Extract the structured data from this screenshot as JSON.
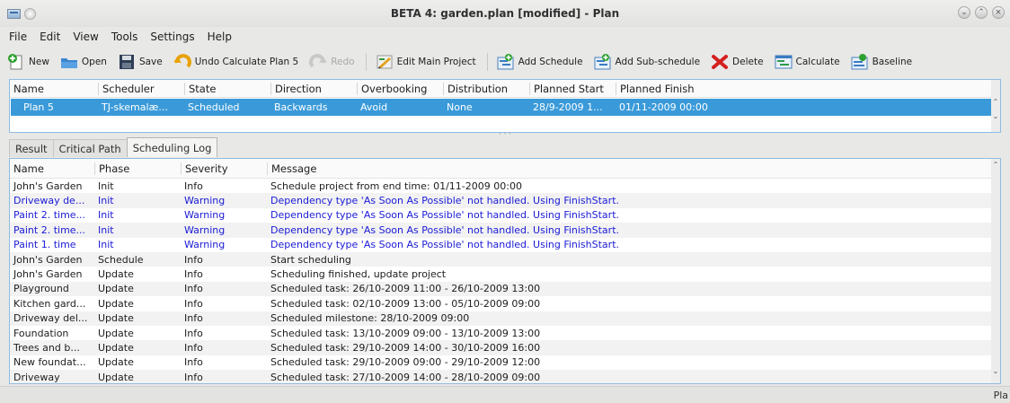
{
  "window": {
    "title": "BETA 4: garden.plan [modified] - Plan"
  },
  "menu": [
    "File",
    "Edit",
    "View",
    "Tools",
    "Settings",
    "Help"
  ],
  "toolbar": {
    "new": "New",
    "open": "Open",
    "save": "Save",
    "undo": "Undo Calculate Plan 5",
    "redo": "Redo",
    "edit_main_project": "Edit Main Project",
    "add_schedule": "Add Schedule",
    "add_subschedule": "Add Sub-schedule",
    "delete": "Delete",
    "calculate": "Calculate",
    "baseline": "Baseline"
  },
  "schedules": {
    "columns": [
      "Name",
      "Scheduler",
      "State",
      "Direction",
      "Overbooking",
      "Distribution",
      "Planned Start",
      "Planned Finish"
    ],
    "row": {
      "name": "Plan 5",
      "scheduler": "TJ-skemalæ...",
      "state": "Scheduled",
      "direction": "Backwards",
      "overbooking": "Avoid",
      "distribution": "None",
      "planned_start": "28/9-2009 1...",
      "planned_finish": "01/11-2009 00:00"
    }
  },
  "tabs": [
    "Result",
    "Critical Path",
    "Scheduling Log"
  ],
  "log": {
    "columns": [
      "Name",
      "Phase",
      "Severity",
      "Message"
    ],
    "rows": [
      {
        "name": "John's Garden",
        "phase": "Init",
        "severity": "Info",
        "message": "Schedule project from end time: 01/11-2009 00:00",
        "warn": false
      },
      {
        "name": "Driveway de...",
        "phase": "Init",
        "severity": "Warning",
        "message": "Dependency type 'As Soon As Possible' not handled. Using FinishStart.",
        "warn": true
      },
      {
        "name": "Paint 2. time...",
        "phase": "Init",
        "severity": "Warning",
        "message": "Dependency type 'As Soon As Possible' not handled. Using FinishStart.",
        "warn": true
      },
      {
        "name": "Paint 2. time...",
        "phase": "Init",
        "severity": "Warning",
        "message": "Dependency type 'As Soon As Possible' not handled. Using FinishStart.",
        "warn": true
      },
      {
        "name": "Paint 1. time",
        "phase": "Init",
        "severity": "Warning",
        "message": "Dependency type 'As Soon As Possible' not handled. Using FinishStart.",
        "warn": true
      },
      {
        "name": "John's Garden",
        "phase": "Schedule",
        "severity": "Info",
        "message": "Start scheduling",
        "warn": false
      },
      {
        "name": "John's Garden",
        "phase": "Update",
        "severity": "Info",
        "message": "Scheduling finished, update project",
        "warn": false
      },
      {
        "name": "Playground",
        "phase": "Update",
        "severity": "Info",
        "message": "Scheduled task: 26/10-2009 11:00 - 26/10-2009 13:00",
        "warn": false
      },
      {
        "name": "Kitchen gard...",
        "phase": "Update",
        "severity": "Info",
        "message": "Scheduled task: 02/10-2009 13:00 - 05/10-2009 09:00",
        "warn": false
      },
      {
        "name": "Driveway del...",
        "phase": "Update",
        "severity": "Info",
        "message": "Scheduled milestone: 28/10-2009 09:00",
        "warn": false
      },
      {
        "name": "Foundation",
        "phase": "Update",
        "severity": "Info",
        "message": "Scheduled task: 13/10-2009 09:00 - 13/10-2009 13:00",
        "warn": false
      },
      {
        "name": "Trees and b...",
        "phase": "Update",
        "severity": "Info",
        "message": "Scheduled task: 29/10-2009 14:00 - 30/10-2009 16:00",
        "warn": false
      },
      {
        "name": "New foundat...",
        "phase": "Update",
        "severity": "Info",
        "message": "Scheduled task: 29/10-2009 09:00 - 29/10-2009 12:00",
        "warn": false
      },
      {
        "name": "Driveway",
        "phase": "Update",
        "severity": "Info",
        "message": "Scheduled task: 27/10-2009 14:00 - 28/10-2009 09:00",
        "warn": false
      }
    ]
  },
  "status": {
    "right": "Pla"
  }
}
